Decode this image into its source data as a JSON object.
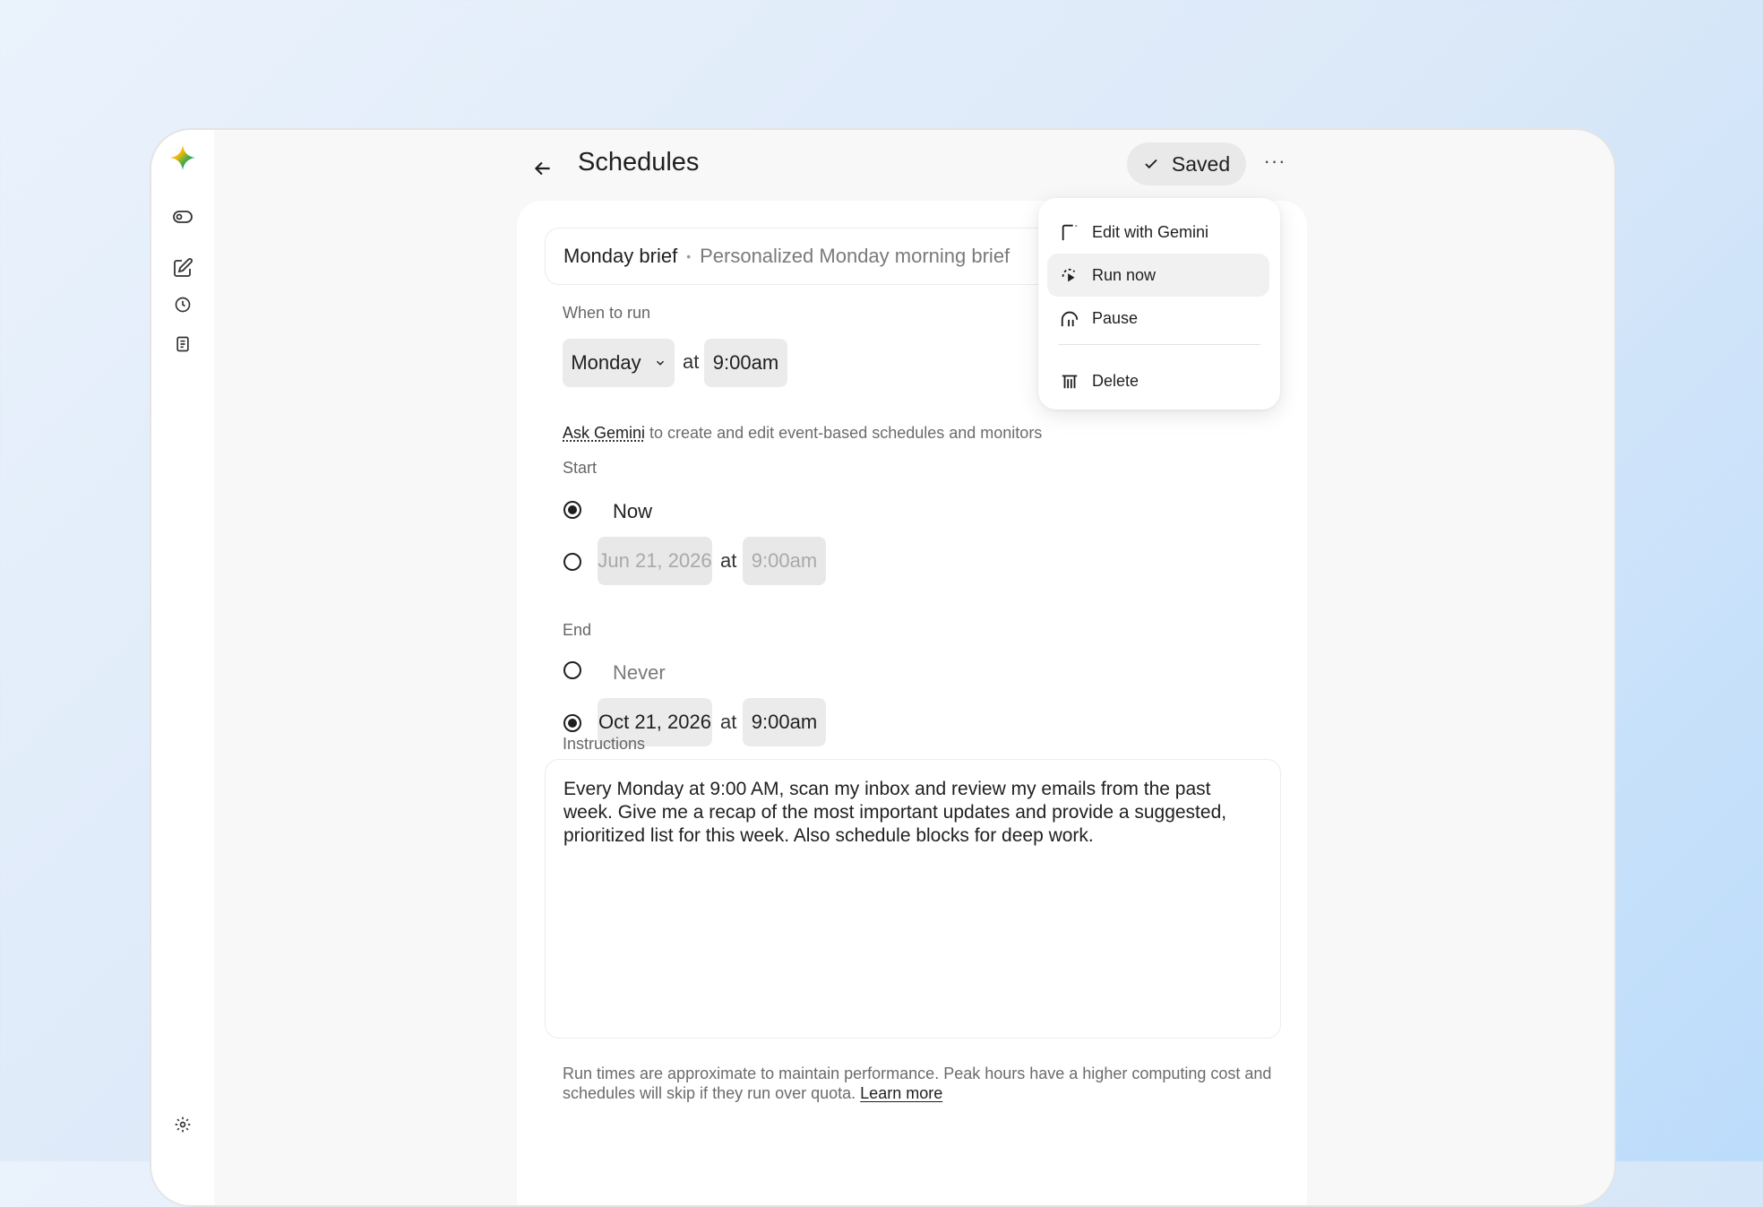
{
  "header": {
    "title": "Schedules",
    "saved_label": "Saved",
    "more_label": "···"
  },
  "schedule": {
    "name": "Monday brief",
    "separator": "•",
    "description": "Personalized Monday morning brief"
  },
  "when_to_run": {
    "label": "When to run",
    "day": "Monday",
    "at": "at",
    "time": "9:00am"
  },
  "hint": {
    "link": "Ask Gemini",
    "text": " to create and edit event-based schedules and monitors"
  },
  "start": {
    "label": "Start",
    "now_label": "Now",
    "date": "Jun 21, 2026",
    "at": "at",
    "time": "9:00am",
    "selected": "now"
  },
  "end": {
    "label": "End",
    "never_label": "Never",
    "date": "Oct 21, 2026",
    "at": "at",
    "time": "9:00am",
    "selected": "date"
  },
  "instructions": {
    "label": "Instructions",
    "text": "Every Monday at 9:00 AM, scan my inbox and review my emails from the past week. Give me a recap of the most important updates and provide a suggested, prioritized list for this week. Also schedule blocks for deep work."
  },
  "footnote": {
    "text": "Run times are approximate to maintain performance. Peak hours have a higher computing cost and schedules will skip if they run over quota. ",
    "link": "Learn more"
  },
  "menu": {
    "items": [
      {
        "label": "Edit with Gemini",
        "icon": "edit-gemini-icon"
      },
      {
        "label": "Run now",
        "icon": "run-now-icon"
      },
      {
        "label": "Pause",
        "icon": "pause-icon"
      },
      {
        "label": "Delete",
        "icon": "delete-icon"
      }
    ],
    "active_item": "Run now"
  },
  "sidebar": {
    "icons": [
      "gemini-logo-icon",
      "toggle-icon",
      "edit-icon",
      "history-icon",
      "notes-icon",
      "settings-icon"
    ]
  },
  "colors": {
    "background": "#dce9f8",
    "card": "#ffffff",
    "chip": "#ebebeb",
    "text": "#1f1f1f"
  }
}
